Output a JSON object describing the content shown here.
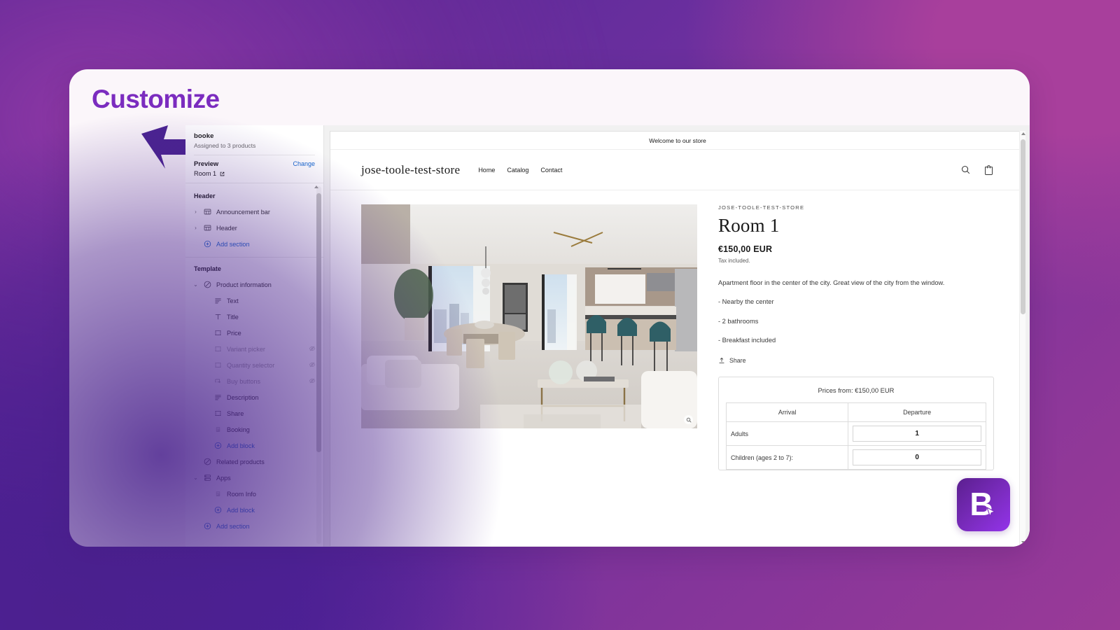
{
  "card": {
    "title": "Customize"
  },
  "sidebar": {
    "theme_name": "booke",
    "theme_sub": "Assigned to 3 products",
    "preview_label": "Preview",
    "change_label": "Change",
    "preview_value": "Room 1",
    "groups": [
      {
        "label": "Header",
        "rows": [
          {
            "label": "Announcement bar",
            "icon": "section-icon",
            "caret": "collapsed",
            "indent": 0,
            "hidden": false,
            "dim": false,
            "link": false
          },
          {
            "label": "Header",
            "icon": "section-icon",
            "caret": "collapsed",
            "indent": 0,
            "hidden": false,
            "dim": false,
            "link": false
          },
          {
            "label": "Add section",
            "icon": "plus-circle-icon",
            "caret": "none",
            "indent": 0,
            "hidden": false,
            "dim": false,
            "link": true
          }
        ]
      },
      {
        "label": "Template",
        "rows": [
          {
            "label": "Product information",
            "icon": "product-icon",
            "caret": "expanded",
            "indent": 0,
            "hidden": false,
            "dim": false,
            "link": false
          },
          {
            "label": "Text",
            "icon": "text-icon",
            "caret": "none",
            "indent": 1,
            "hidden": false,
            "dim": false,
            "link": false
          },
          {
            "label": "Title",
            "icon": "title-icon",
            "caret": "none",
            "indent": 1,
            "hidden": false,
            "dim": false,
            "link": false
          },
          {
            "label": "Price",
            "icon": "block-icon",
            "caret": "none",
            "indent": 1,
            "hidden": false,
            "dim": false,
            "link": false
          },
          {
            "label": "Variant picker",
            "icon": "block-icon",
            "caret": "none",
            "indent": 1,
            "hidden": true,
            "dim": true,
            "link": false
          },
          {
            "label": "Quantity selector",
            "icon": "block-icon",
            "caret": "none",
            "indent": 1,
            "hidden": true,
            "dim": true,
            "link": false
          },
          {
            "label": "Buy buttons",
            "icon": "buy-button-icon",
            "caret": "none",
            "indent": 1,
            "hidden": true,
            "dim": true,
            "link": false
          },
          {
            "label": "Description",
            "icon": "text-icon",
            "caret": "none",
            "indent": 1,
            "hidden": false,
            "dim": false,
            "link": false
          },
          {
            "label": "Share",
            "icon": "block-icon",
            "caret": "none",
            "indent": 1,
            "hidden": false,
            "dim": false,
            "link": false
          },
          {
            "label": "Booking",
            "icon": "app-block-icon",
            "caret": "none",
            "indent": 1,
            "hidden": false,
            "dim": false,
            "link": false
          },
          {
            "label": "Add block",
            "icon": "plus-circle-icon",
            "caret": "none",
            "indent": 1,
            "hidden": false,
            "dim": false,
            "link": true
          },
          {
            "label": "Related products",
            "icon": "product-icon",
            "caret": "none",
            "indent": 0,
            "hidden": false,
            "dim": false,
            "link": false
          },
          {
            "label": "Apps",
            "icon": "apps-icon",
            "caret": "expanded",
            "indent": 0,
            "hidden": false,
            "dim": false,
            "link": false
          },
          {
            "label": "Room Info",
            "icon": "app-block-icon",
            "caret": "none",
            "indent": 1,
            "hidden": false,
            "dim": false,
            "link": false
          },
          {
            "label": "Add block",
            "icon": "plus-circle-icon",
            "caret": "none",
            "indent": 1,
            "hidden": false,
            "dim": false,
            "link": true
          },
          {
            "label": "Add section",
            "icon": "plus-circle-icon",
            "caret": "none",
            "indent": 0,
            "hidden": false,
            "dim": false,
            "link": true
          }
        ]
      }
    ]
  },
  "preview": {
    "announcement": "Welcome to our store",
    "store_name": "jose-toole-test-store",
    "nav": [
      "Home",
      "Catalog",
      "Contact"
    ],
    "icons": [
      "search-icon",
      "cart-icon"
    ],
    "product": {
      "vendor": "JOSE-TOOLE-TEST-STORE",
      "title": "Room 1",
      "price": "€150,00 EUR",
      "tax_note": "Tax included.",
      "description": [
        "Apartment floor in the center of the city. Great view of the city from the window.",
        "- Nearby the center",
        "- 2 bathrooms",
        "- Breakfast included"
      ],
      "share_label": "Share"
    },
    "booking": {
      "prices_from": "Prices from: €150,00 EUR",
      "columns": [
        "Arrival",
        "Departure"
      ],
      "rows": [
        {
          "label": "Adults",
          "value": "1"
        },
        {
          "label": "Children (ages 2 to 7):",
          "value": "0"
        }
      ]
    }
  },
  "badge": {
    "letter": "B"
  },
  "colors": {
    "accent_purple": "#7b2cbf",
    "link_blue": "#1668cf",
    "bg_start": "#4b2496",
    "bg_end": "#9a3a97"
  }
}
